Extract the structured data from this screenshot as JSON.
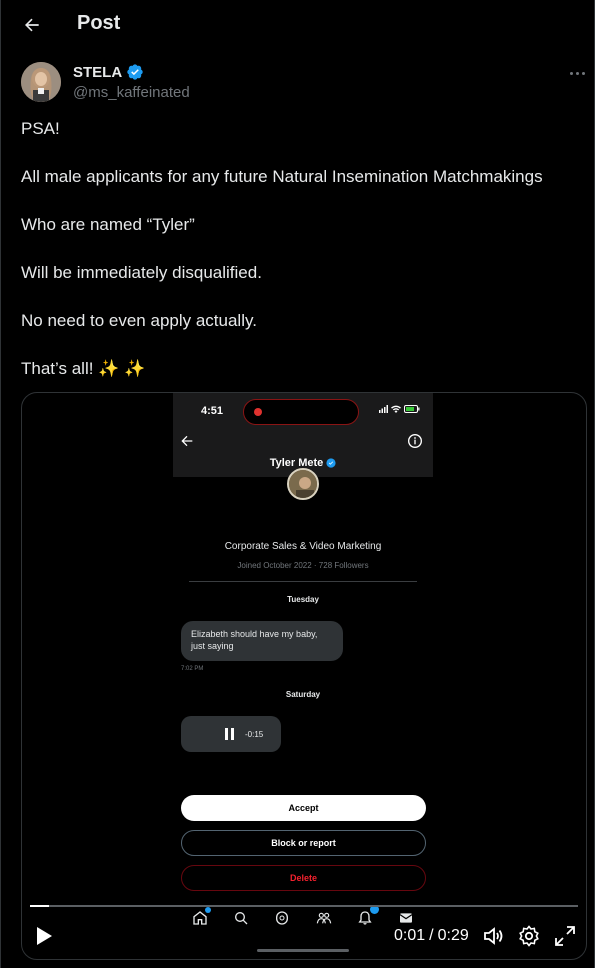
{
  "header": {
    "title": "Post",
    "back_icon": "arrow-left-icon"
  },
  "author": {
    "name": "STELA",
    "handle": "@ms_kaffeinated",
    "verified": true,
    "verified_color": "#1d9bf0",
    "more_icon": "more-horizontal-icon"
  },
  "post": {
    "lines": [
      "PSA!",
      "All male applicants for any future Natural Insemination Matchmakings",
      "Who are named “Tyler”",
      "Will be immediately disqualified.",
      "No need to even apply actually.",
      "That’s all! ✨ ✨"
    ]
  },
  "media": {
    "phone": {
      "time": "4:51",
      "contact_name": "Tyler Mete",
      "contact_verified": true,
      "bio": "Corporate Sales & Video Marketing",
      "meta": "Joined October 2022 · 728 Followers",
      "day1": "Tuesday",
      "message": "Elizabeth should have my baby, just saying",
      "message_time": "7:02 PM",
      "day2": "Saturday",
      "audio_time": "-0:15",
      "accept_label": "Accept",
      "block_label": "Block or report",
      "delete_label": "Delete",
      "tabs": [
        "home-icon",
        "search-icon",
        "grok-icon",
        "communities-icon",
        "notifications-icon",
        "messages-icon"
      ]
    },
    "player": {
      "current_time": "0:01",
      "separator": "/",
      "duration": "0:29",
      "progress_fraction": 0.034,
      "controls": [
        "play-icon",
        "volume-icon",
        "settings-icon",
        "fullscreen-icon"
      ]
    }
  },
  "colors": {
    "background": "#000000",
    "text": "#e7e9ea",
    "muted": "#71767b",
    "accent": "#1d9bf0",
    "danger": "#f4212e"
  }
}
